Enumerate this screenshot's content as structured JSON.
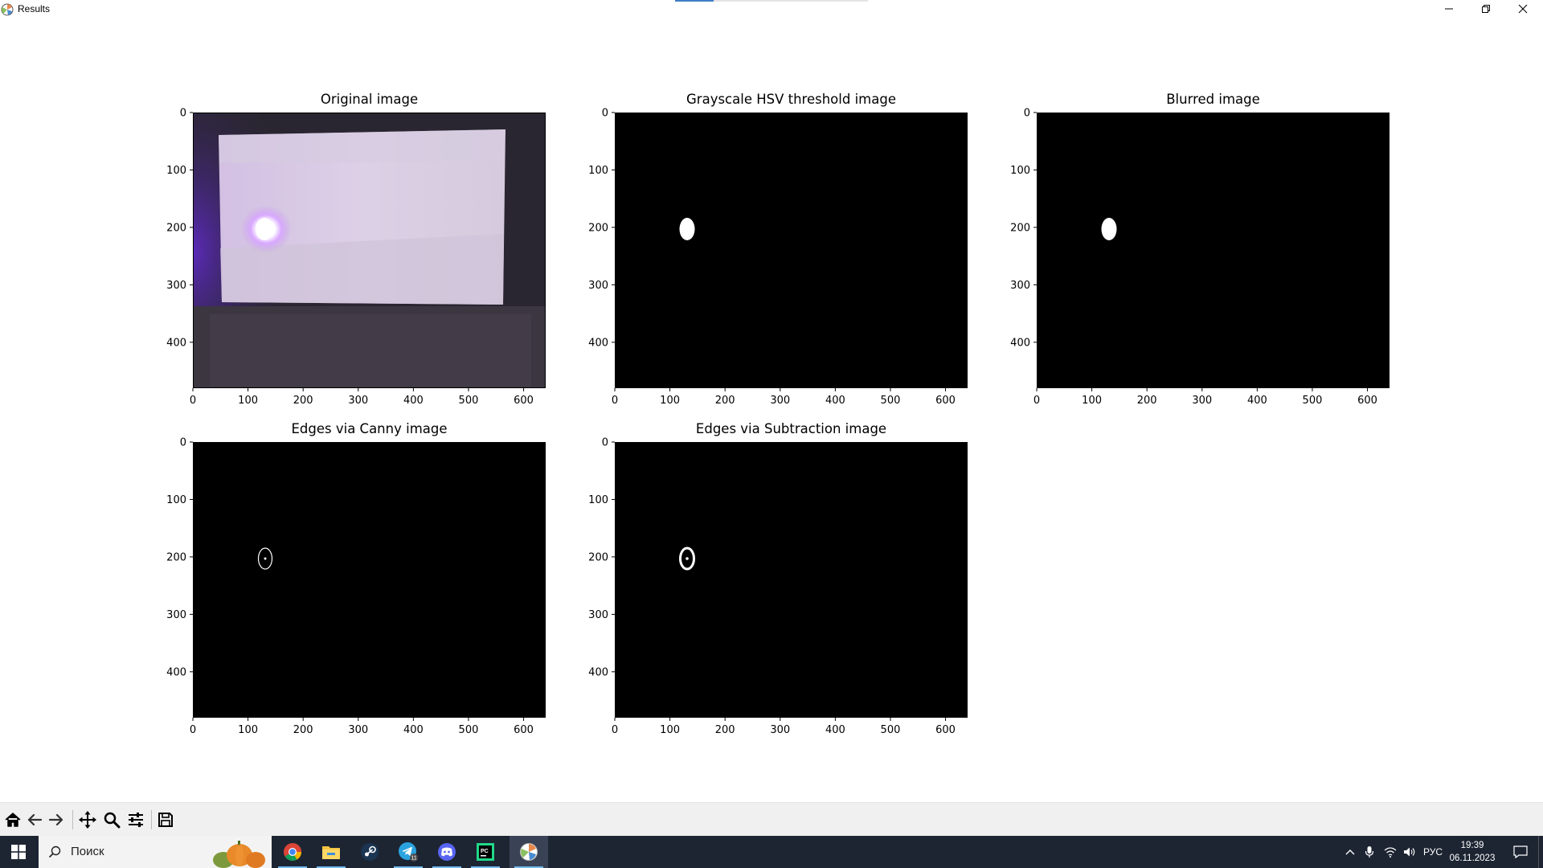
{
  "window": {
    "title": "Results",
    "controls": {
      "minimize_icon": "minimize-icon",
      "maximize_icon": "restore-icon",
      "close_icon": "close-icon"
    }
  },
  "chart_data": [
    {
      "type": "image",
      "title": "Original image",
      "image_description": "camera photo: white sheet on dark background, violet laser spot",
      "x_ticks": [
        "0",
        "100",
        "200",
        "300",
        "400",
        "500",
        "600"
      ],
      "y_ticks": [
        "0",
        "100",
        "200",
        "300",
        "400"
      ],
      "xlim": [
        0,
        640
      ],
      "ylim": [
        480,
        0
      ],
      "spot": {
        "x": 130,
        "y": 200
      }
    },
    {
      "type": "image",
      "title": "Grayscale HSV threshold image",
      "image_description": "black background with white blob",
      "x_ticks": [
        "0",
        "100",
        "200",
        "300",
        "400",
        "500",
        "600"
      ],
      "y_ticks": [
        "0",
        "100",
        "200",
        "300",
        "400"
      ],
      "xlim": [
        0,
        640
      ],
      "ylim": [
        480,
        0
      ],
      "blob": {
        "x": 130,
        "y": 200
      }
    },
    {
      "type": "image",
      "title": "Blurred image",
      "image_description": "black background with white blob",
      "x_ticks": [
        "0",
        "100",
        "200",
        "300",
        "400",
        "500",
        "600"
      ],
      "y_ticks": [
        "0",
        "100",
        "200",
        "300",
        "400"
      ],
      "xlim": [
        0,
        640
      ],
      "ylim": [
        480,
        0
      ],
      "blob": {
        "x": 130,
        "y": 200
      }
    },
    {
      "type": "image",
      "title": "Edges via Canny image",
      "image_description": "black background with thin white ellipse outline",
      "x_ticks": [
        "0",
        "100",
        "200",
        "300",
        "400",
        "500",
        "600"
      ],
      "y_ticks": [
        "0",
        "100",
        "200",
        "300",
        "400"
      ],
      "xlim": [
        0,
        640
      ],
      "ylim": [
        480,
        0
      ],
      "outline": {
        "x": 130,
        "y": 200
      }
    },
    {
      "type": "image",
      "title": "Edges via Subtraction image",
      "image_description": "black background with thick white ellipse outline",
      "x_ticks": [
        "0",
        "100",
        "200",
        "300",
        "400",
        "500",
        "600"
      ],
      "y_ticks": [
        "0",
        "100",
        "200",
        "300",
        "400"
      ],
      "xlim": [
        0,
        640
      ],
      "ylim": [
        480,
        0
      ],
      "outline": {
        "x": 130,
        "y": 200
      }
    }
  ],
  "toolbar": {
    "buttons": [
      {
        "name": "home-icon"
      },
      {
        "name": "back-arrow-icon"
      },
      {
        "name": "forward-arrow-icon"
      },
      {
        "name": "pan-icon"
      },
      {
        "name": "zoom-icon"
      },
      {
        "name": "configure-subplots-icon"
      },
      {
        "name": "save-icon"
      }
    ]
  },
  "taskbar": {
    "search_placeholder": "Поиск",
    "apps": [
      "chrome-icon",
      "file-explorer-icon",
      "steam-icon",
      "telegram-icon",
      "discord-icon",
      "pycharm-icon",
      "matplotlib-icon"
    ],
    "telegram_badge": "11",
    "language": "РУС",
    "time": "19:39",
    "date": "06.11.2023"
  }
}
